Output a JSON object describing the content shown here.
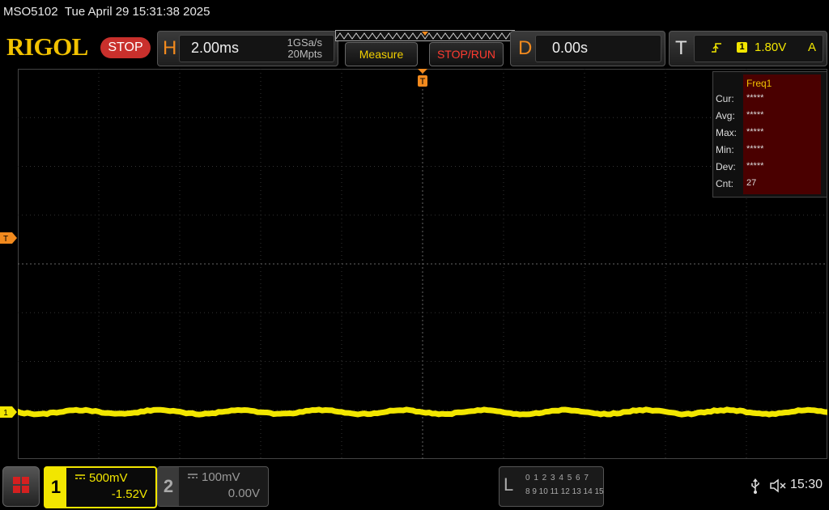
{
  "title_bar": {
    "model": "MSO5102",
    "datetime": "Tue April 29 15:31:38 2025"
  },
  "brand": "RIGOL",
  "run_status": "STOP",
  "horizontal": {
    "letter": "H",
    "timebase": "2.00ms",
    "sample_rate": "1GSa/s",
    "memory_depth": "20Mpts"
  },
  "toolbar": {
    "measure_label": "Measure",
    "stoprun_label": "STOP/RUN"
  },
  "delay": {
    "letter": "D",
    "value": "0.00s"
  },
  "trigger": {
    "letter": "T",
    "source": "1",
    "level": "1.80V",
    "mode": "A"
  },
  "grid_markers": {
    "trigger_position": "T",
    "trigger_level": "T",
    "ch1_ground": "1"
  },
  "measurement": {
    "title": "Freq1",
    "rows": [
      {
        "label": "Cur:",
        "value": "*****"
      },
      {
        "label": "Avg:",
        "value": "*****"
      },
      {
        "label": "Max:",
        "value": "*****"
      },
      {
        "label": "Min:",
        "value": "*****"
      },
      {
        "label": "Dev:",
        "value": "*****"
      },
      {
        "label": "Cnt:",
        "value": "27"
      }
    ]
  },
  "channels": {
    "ch1": {
      "number": "1",
      "scale": "500mV",
      "offset": "-1.52V"
    },
    "ch2": {
      "number": "2",
      "scale": "100mV",
      "offset": "0.00V"
    }
  },
  "logic_analyzer": {
    "letter": "L",
    "row1": "0 1 2 3   4 5 6 7",
    "row2": "8  9 10 11  12 13 14 15"
  },
  "status": {
    "time": "15:30"
  },
  "colors": {
    "ch1": "#f2e600",
    "trigger": "#f28a1e",
    "stop": "#c9302c",
    "brand": "#f2c200"
  },
  "icons": [
    "menu-icon",
    "trigger-rising-edge-icon",
    "dc-coupling-icon",
    "usb-icon",
    "speaker-muted-icon"
  ]
}
